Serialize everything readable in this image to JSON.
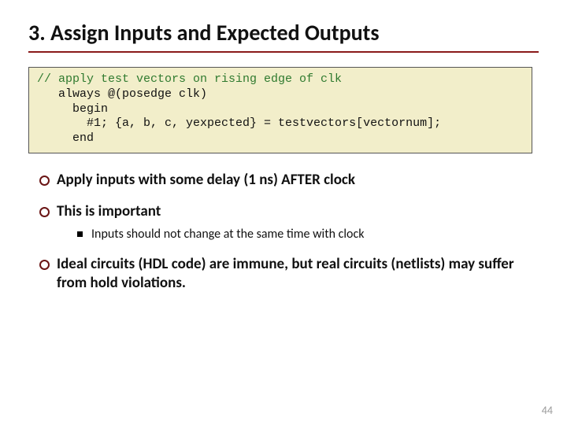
{
  "title": "3. Assign Inputs and Expected Outputs",
  "code": {
    "comment": "// apply test vectors on rising edge of clk",
    "l1": "   always @(posedge clk)",
    "l2": "     begin",
    "l3": "       #1; {a, b, c, yexpected} = testvectors[vectornum];",
    "l4": "     end"
  },
  "bullets": {
    "b1": "Apply inputs with some delay (1 ns) AFTER clock",
    "b2": "This is important",
    "b2_sub1": "Inputs should not change at the same time with clock",
    "b3": "Ideal circuits (HDL code) are immune, but real circuits (netlists) may suffer from hold violations."
  },
  "page": "44"
}
